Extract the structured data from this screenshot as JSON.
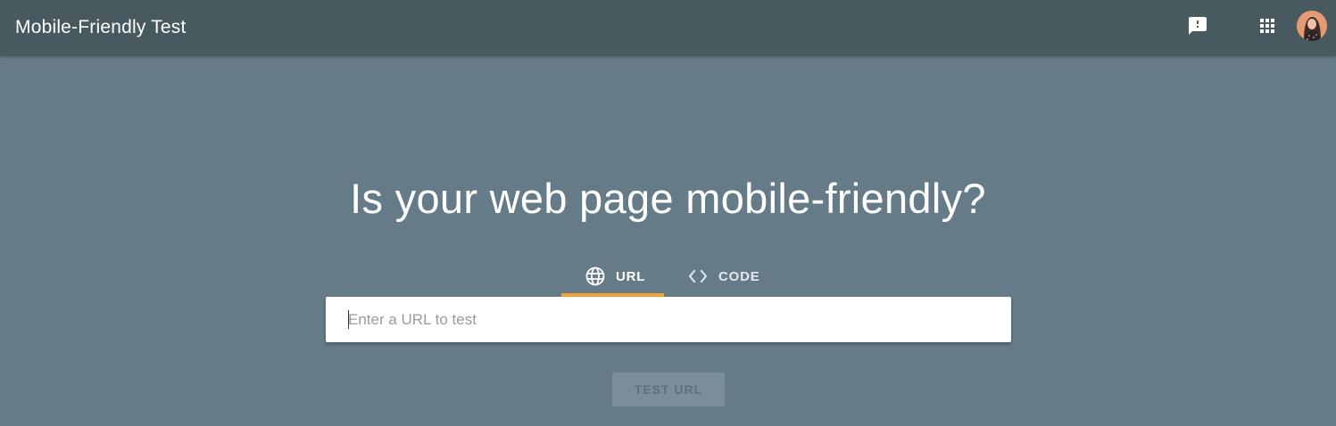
{
  "header": {
    "app_title": "Mobile-Friendly Test",
    "icons": [
      "feedback-icon",
      "apps-grid-icon"
    ],
    "avatar": "user-avatar"
  },
  "main": {
    "headline": "Is your web page mobile-friendly?",
    "tabs": [
      {
        "label": "URL",
        "icon": "globe-icon",
        "active": true
      },
      {
        "label": "CODE",
        "icon": "code-icon",
        "active": false
      }
    ],
    "url_input": {
      "placeholder": "Enter a URL to test",
      "value": ""
    },
    "test_button_label": "TEST URL"
  },
  "colors": {
    "header_bg": "#48595f",
    "page_bg": "#667b88",
    "tab_indicator": "#f6a33a",
    "button_bg": "#7a8d99"
  }
}
